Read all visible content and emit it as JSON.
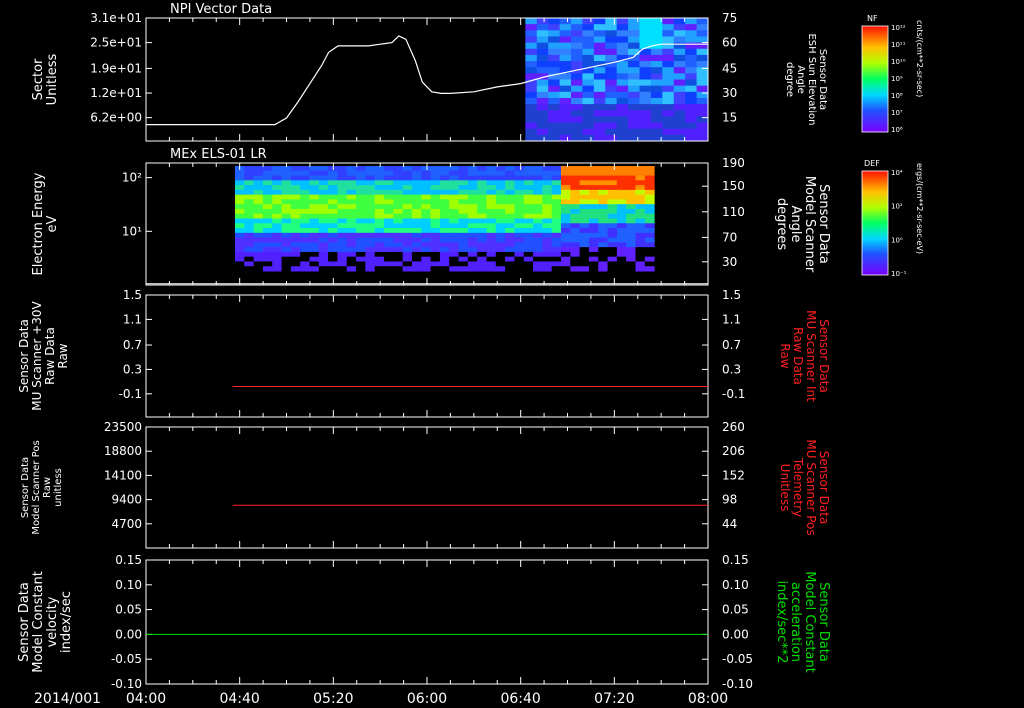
{
  "time_axis": {
    "date_label": "2014/001",
    "start_minutes": 240,
    "end_minutes": 480,
    "ticks": [
      {
        "min": 240,
        "label": "04:00"
      },
      {
        "min": 280,
        "label": "04:40"
      },
      {
        "min": 320,
        "label": "05:20"
      },
      {
        "min": 360,
        "label": "06:00"
      },
      {
        "min": 400,
        "label": "06:40"
      },
      {
        "min": 440,
        "label": "07:20"
      },
      {
        "min": 480,
        "label": "08:00"
      }
    ]
  },
  "colors": {
    "axis": "#ffffff",
    "red_trace": "#ff2020",
    "green_trace": "#00e000",
    "white_trace": "#ffffff"
  },
  "colorbars": [
    {
      "title": "NF",
      "unit": "cnts/(cm**2-sr-sec)",
      "top_label": "10¹²",
      "mid_labels": [
        "10¹¹",
        "10¹⁰",
        "10⁹",
        "10⁸",
        "10⁷"
      ],
      "bottom_label": "10⁶"
    },
    {
      "title": "DEF",
      "unit": "ergs/(cm**2-sr-sec-eV)",
      "top_label": "10⁴",
      "mid_labels": [
        "10²",
        "10⁰"
      ],
      "bottom_label": "10⁻¹"
    }
  ],
  "chart_data": [
    {
      "type": "heatmap",
      "title": "NPI Vector Data",
      "ylabel_left": [
        "Sector",
        "Unitless"
      ],
      "yticks_left": [
        "3.1e+01",
        "2.5e+01",
        "1.9e+01",
        "1.2e+01",
        "6.2e+00"
      ],
      "ylabel_right": [
        "Sensor Data",
        "ESH Sun Elevation",
        "Angle",
        "degree"
      ],
      "yticks_right": [
        "75",
        "60",
        "45",
        "30",
        "15"
      ],
      "yrange_right": [
        0,
        75
      ],
      "heatmap_time_range": [
        402,
        480
      ],
      "line_series": {
        "name": "ESH Sun Elevation Angle",
        "color": "white",
        "points": [
          [
            240,
            10
          ],
          [
            295,
            10
          ],
          [
            300,
            14
          ],
          [
            305,
            24
          ],
          [
            310,
            35
          ],
          [
            315,
            46
          ],
          [
            318,
            54
          ],
          [
            322,
            58
          ],
          [
            335,
            58
          ],
          [
            340,
            59
          ],
          [
            345,
            60
          ],
          [
            348,
            64
          ],
          [
            351,
            62
          ],
          [
            355,
            49
          ],
          [
            358,
            36
          ],
          [
            362,
            30
          ],
          [
            366,
            29
          ],
          [
            370,
            29
          ],
          [
            380,
            30
          ],
          [
            390,
            33
          ],
          [
            400,
            35
          ],
          [
            410,
            39
          ],
          [
            420,
            42
          ],
          [
            430,
            45
          ],
          [
            440,
            48
          ],
          [
            448,
            51
          ],
          [
            452,
            56
          ],
          [
            456,
            58
          ],
          [
            460,
            59
          ],
          [
            480,
            59
          ]
        ]
      }
    },
    {
      "type": "heatmap",
      "title": "MEx ELS-01 LR",
      "ylabel_left": [
        "Electron Energy",
        "eV"
      ],
      "yticks_left": [
        "10²",
        "10¹"
      ],
      "ylabel_right": [
        "Sensor Data",
        "Model Scanner",
        "Angle",
        "degrees"
      ],
      "yticks_right": [
        "190",
        "150",
        "110",
        "70",
        "30"
      ],
      "yrange_right": [
        0,
        190
      ],
      "heatmap_time_range": [
        278,
        457
      ],
      "line_series": {
        "name": "Model Scanner Angle",
        "color": "white",
        "points": [
          [
            240,
            2
          ],
          [
            480,
            2
          ]
        ]
      }
    },
    {
      "type": "line",
      "ylabel_left": [
        "Sensor Data",
        "MU Scanner +30V",
        "Raw Data",
        "Raw"
      ],
      "yticks_left": [
        "1.5",
        "1.1",
        "0.7",
        "0.3",
        "-0.1"
      ],
      "yrange_left": [
        -0.5,
        1.5
      ],
      "ylabel_right": [
        "Sensor Data",
        "MU Scanner Int",
        "Raw Data",
        "Raw"
      ],
      "yticks_right": [
        "1.5",
        "1.1",
        "0.7",
        "0.3",
        "-0.1"
      ],
      "series": [
        {
          "color": "red",
          "points": [
            [
              277,
              0.0
            ],
            [
              480,
              0.0
            ]
          ]
        }
      ]
    },
    {
      "type": "line",
      "ylabel_left": [
        "Sensor Data",
        "Model Scanner Pos",
        "Raw",
        "unitless"
      ],
      "yticks_left": [
        "23500",
        "18800",
        "14100",
        "9400",
        "4700"
      ],
      "yrange_left": [
        0,
        23500
      ],
      "ylabel_right": [
        "Sensor Data",
        "MU Scanner Pos",
        "Telemetry",
        "Unitless"
      ],
      "yticks_right": [
        "260",
        "206",
        "152",
        "98",
        "44"
      ],
      "series": [
        {
          "color": "red",
          "points": [
            [
              277,
              8300
            ],
            [
              480,
              8300
            ]
          ]
        }
      ]
    },
    {
      "type": "line",
      "ylabel_left": [
        "Sensor Data",
        "Model Constant",
        "velocity",
        "index/sec"
      ],
      "yticks_left": [
        "0.15",
        "0.10",
        "0.05",
        "0.00",
        "-0.05",
        "-0.10"
      ],
      "yrange_left": [
        -0.1,
        0.15
      ],
      "ylabel_right": [
        "Sensor Data",
        "Model Constant",
        "acceleration",
        "index/sec**2"
      ],
      "yticks_right": [
        "0.15",
        "0.10",
        "0.05",
        "0.00",
        "-0.05",
        "-0.10"
      ],
      "series": [
        {
          "color": "green",
          "points": [
            [
              240,
              0.0
            ],
            [
              480,
              0.0
            ]
          ]
        }
      ]
    }
  ]
}
